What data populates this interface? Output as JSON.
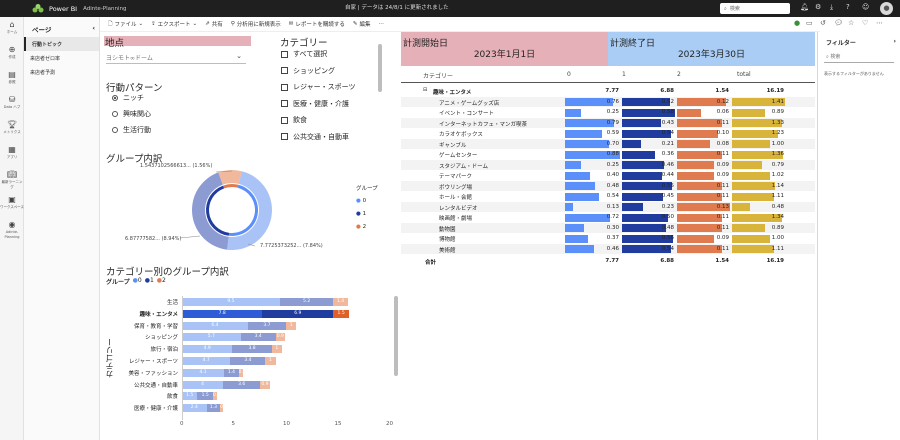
{
  "topbar": {
    "app": "Power BI",
    "workspace": "Adinte-Planning",
    "report_name": "自家",
    "refresh": "データは 24/8/1 に更新されました",
    "search_placeholder": "検索"
  },
  "leftnav": [
    {
      "icon": "home-icon",
      "label": "ホーム"
    },
    {
      "icon": "create-icon",
      "label": "作成"
    },
    {
      "icon": "browse-icon",
      "label": "参照"
    },
    {
      "icon": "datahub-icon",
      "label": "Data ハブ"
    },
    {
      "icon": "metrics-icon",
      "label": "メトリクス"
    },
    {
      "icon": "apps-icon",
      "label": "アプリ"
    },
    {
      "icon": "learn-icon",
      "label": "最新ラーニング"
    },
    {
      "icon": "workspaces-icon",
      "label": "ワークスペース"
    },
    {
      "icon": "adinte-icon",
      "label": "Adinte-Planning"
    }
  ],
  "pages": {
    "header": "ページ",
    "items": [
      "行動トピック",
      "来店者ゼロ率",
      "来店者予測"
    ]
  },
  "toolbar": {
    "file": "ファイル",
    "export": "エクスポート",
    "share": "共有",
    "explore": "分析用に新規表示",
    "subscribe": "レポートを購読する",
    "edit": "編集"
  },
  "location": {
    "title": "地点",
    "value": "ヨシモト∞ドーム"
  },
  "pattern": {
    "title": "行動パターン",
    "options": [
      "ニッチ",
      "興味関心",
      "生活行動"
    ],
    "selected": 0
  },
  "category": {
    "title": "カテゴリー",
    "items": [
      "すべて選択",
      "ショッピング",
      "レジャー・スポーツ",
      "医療・健康・介護",
      "飲食",
      "公共交通・自動車"
    ]
  },
  "donut": {
    "title": "グループ内訳",
    "legend_title": "グループ",
    "labels": [
      "1.5437102566613... (1.56%)",
      "6.87777582... (8.94%)",
      "7.7725373252... (7.84%)"
    ]
  },
  "colors": {
    "g0": "#5b8ff9",
    "g1": "#1f3c9e",
    "g2": "#e07b4f",
    "total": "#d9b43a",
    "loc_band": "#e6b0b8",
    "start_band": "#e6b0b8",
    "end_band": "#a9cdf5"
  },
  "dates": {
    "start_label": "計測開始日",
    "start_value": "2023年1月1日",
    "end_label": "計測終了日",
    "end_value": "2023年3月30日"
  },
  "matrix": {
    "headers": [
      "カテゴリー",
      "0",
      "1",
      "2",
      "total"
    ],
    "group": {
      "label": "趣味・エンタメ",
      "values": [
        "7.77",
        "6.88",
        "1.54",
        "16.19"
      ]
    },
    "rows": [
      {
        "label": "アニメ・ゲームグッズ店",
        "values": [
          "0.76",
          "0.52",
          "0.12",
          "1.41"
        ],
        "frac": [
          0.76,
          0.52,
          0.12,
          1.41
        ]
      },
      {
        "label": "イベント・コンサート",
        "values": [
          "0.25",
          "0.58",
          "0.06",
          "0.89"
        ],
        "frac": [
          0.25,
          0.58,
          0.06,
          0.89
        ]
      },
      {
        "label": "インターネットカフェ・マンガ喫茶",
        "values": [
          "0.79",
          "0.43",
          "0.11",
          "1.33"
        ],
        "frac": [
          0.79,
          0.43,
          0.11,
          1.33
        ]
      },
      {
        "label": "カラオケボックス",
        "values": [
          "0.59",
          "0.54",
          "0.10",
          "1.23"
        ],
        "frac": [
          0.59,
          0.54,
          0.1,
          1.23
        ]
      },
      {
        "label": "ギャンブル",
        "values": [
          "0.70",
          "0.21",
          "0.08",
          "1.00"
        ],
        "frac": [
          0.7,
          0.21,
          0.08,
          1.0
        ]
      },
      {
        "label": "ゲームセンター",
        "values": [
          "0.88",
          "0.36",
          "0.11",
          "1.36"
        ],
        "frac": [
          0.88,
          0.36,
          0.11,
          1.36
        ]
      },
      {
        "label": "スタジアム・ドーム",
        "values": [
          "0.25",
          "0.46",
          "0.09",
          "0.79"
        ],
        "frac": [
          0.25,
          0.46,
          0.09,
          0.79
        ]
      },
      {
        "label": "テーマパーク",
        "values": [
          "0.40",
          "0.44",
          "0.09",
          "1.02"
        ],
        "frac": [
          0.4,
          0.44,
          0.09,
          1.02
        ]
      },
      {
        "label": "ボウリング場",
        "values": [
          "0.48",
          "0.55",
          "0.11",
          "1.14"
        ],
        "frac": [
          0.48,
          0.55,
          0.11,
          1.14
        ]
      },
      {
        "label": "ホール・会館",
        "values": [
          "0.54",
          "0.45",
          "0.11",
          "1.11"
        ],
        "frac": [
          0.54,
          0.45,
          0.11,
          1.11
        ]
      },
      {
        "label": "レンタルビデオ",
        "values": [
          "0.13",
          "0.23",
          "0.13",
          "0.48"
        ],
        "frac": [
          0.13,
          0.23,
          0.13,
          0.48
        ]
      },
      {
        "label": "映画館・劇場",
        "values": [
          "0.72",
          "0.50",
          "0.11",
          "1.34"
        ],
        "frac": [
          0.72,
          0.5,
          0.11,
          1.34
        ]
      },
      {
        "label": "動物園",
        "values": [
          "0.30",
          "0.48",
          "0.11",
          "0.89"
        ],
        "frac": [
          0.3,
          0.48,
          0.11,
          0.89
        ]
      },
      {
        "label": "博物館",
        "values": [
          "0.37",
          "0.56",
          "0.09",
          "1.00"
        ],
        "frac": [
          0.37,
          0.56,
          0.09,
          1.0
        ]
      },
      {
        "label": "美術館",
        "values": [
          "0.46",
          "0.54",
          "0.11",
          "1.11"
        ],
        "frac": [
          0.46,
          0.54,
          0.11,
          1.11
        ]
      }
    ],
    "total": {
      "label": "合計",
      "values": [
        "7.77",
        "6.88",
        "1.54",
        "16.19"
      ]
    }
  },
  "filters": {
    "title": "フィルター",
    "search": "検索",
    "note": "表示するフィルターがありません"
  },
  "chart_data": [
    {
      "type": "pie",
      "title": "グループ内訳",
      "categories": [
        "0",
        "1",
        "2"
      ],
      "values": [
        7.7725373252,
        6.87777582,
        1.5437102566613
      ],
      "legend": "right"
    },
    {
      "type": "bar",
      "title": "カテゴリー別のグループ内訳",
      "ylabel": "カテゴリー",
      "legend_title": "グループ",
      "categories": [
        "生活",
        "趣味・エンタメ",
        "保育・教育・学習",
        "ショッピング",
        "旅行・宿泊",
        "レジャー・スポーツ",
        "美容・ファッション",
        "公共交通・自動車",
        "飲食",
        "医療・健康・介護"
      ],
      "series": [
        {
          "name": "0",
          "values": [
            9.5,
            7.8,
            6.4,
            5.7,
            4.9,
            4.7,
            4.1,
            4.0,
            1.5,
            2.4
          ]
        },
        {
          "name": "1",
          "values": [
            5.2,
            6.9,
            3.7,
            3.4,
            3.8,
            3.4,
            1.4,
            3.6,
            1.5,
            1.3
          ]
        },
        {
          "name": "2",
          "values": [
            1.4,
            1.5,
            1.0,
            0.9,
            1.0,
            1.0,
            0.4,
            0.9,
            0.4,
            0.3
          ]
        }
      ],
      "xlim": [
        0,
        20
      ],
      "xticks": [
        "0",
        "5",
        "10",
        "15",
        "20"
      ]
    }
  ]
}
